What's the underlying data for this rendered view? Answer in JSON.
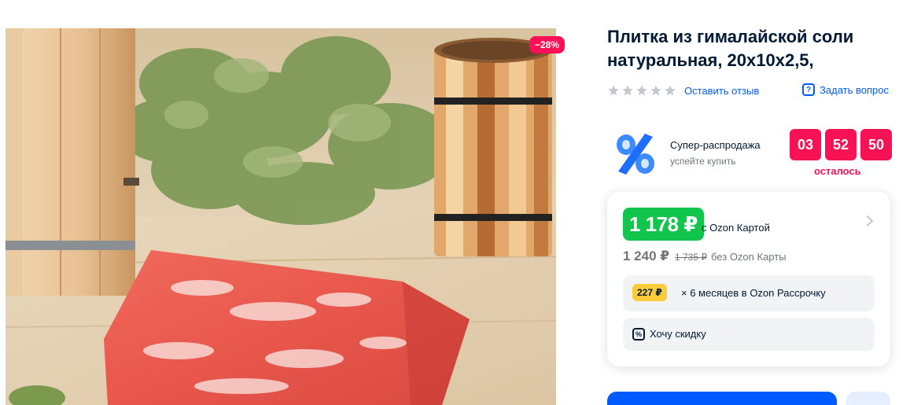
{
  "product": {
    "title": "Плитка из гималайской соли натуральная, 20x10x2,5,",
    "discount_badge": "−28%"
  },
  "rating": {
    "stars_filled": 0,
    "stars_total": 5,
    "review_link": "Оставить отзыв",
    "ask_link": "Задать вопрос"
  },
  "promo": {
    "title": "Супер-распродажа",
    "subtitle": "успейте купить",
    "timer": [
      "03",
      "52",
      "50"
    ],
    "timer_label": "осталось"
  },
  "price": {
    "ozon_card_price": "1 178 ₽",
    "ozon_card_label": "с Ozon Картой",
    "regular_price": "1 240 ₽",
    "old_price": "1 735 ₽",
    "regular_label": "без Ozon Карты",
    "installment_amount": "227 ₽",
    "installment_text": "× 6 месяцев в Ozon Рассрочку",
    "want_discount": "Хочу скидку"
  },
  "colors": {
    "accent_blue": "#005bff",
    "sale_red": "#f91155",
    "ozon_green": "#10c44c",
    "installment_yellow": "#fbcb3a"
  }
}
